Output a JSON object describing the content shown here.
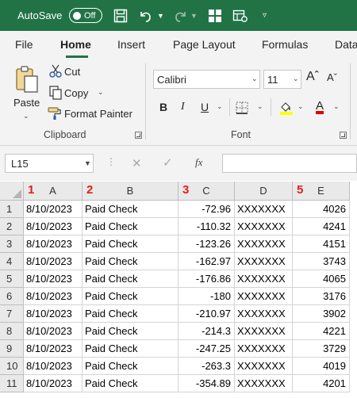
{
  "titlebar": {
    "autosave_label": "AutoSave",
    "toggle_label": "Off",
    "icons": [
      "save-icon",
      "undo-icon",
      "redo-icon",
      "table-icon",
      "form-icon",
      "customize-icon"
    ]
  },
  "tabs": [
    {
      "label": "File",
      "active": false
    },
    {
      "label": "Home",
      "active": true
    },
    {
      "label": "Insert",
      "active": false
    },
    {
      "label": "Page Layout",
      "active": false
    },
    {
      "label": "Formulas",
      "active": false
    },
    {
      "label": "Data",
      "active": false
    }
  ],
  "clipboard": {
    "paste_label": "Paste",
    "cut_label": "Cut",
    "copy_label": "Copy",
    "format_painter_label": "Format Painter",
    "group_label": "Clipboard"
  },
  "font": {
    "font_name": "Calibri",
    "font_size": "11",
    "bold": "B",
    "italic": "I",
    "underline": "U",
    "grow": "Aˆ",
    "shrink": "Aˇ",
    "color_a": "A",
    "group_label": "Font",
    "fill_color": "#ffff00",
    "font_color": "#e00000"
  },
  "formula_bar": {
    "name_box": "L15",
    "fx": "fx"
  },
  "grid": {
    "columns": [
      "A",
      "B",
      "C",
      "D",
      "E"
    ],
    "annotations": {
      "A": "1",
      "B": "2",
      "C": "3",
      "E": "5"
    },
    "rows": [
      {
        "n": "1",
        "A": "8/10/2023",
        "B": "Paid Check",
        "C": "-72.96",
        "D": "XXXXXXX",
        "E": "4026"
      },
      {
        "n": "2",
        "A": "8/10/2023",
        "B": "Paid Check",
        "C": "-110.32",
        "D": "XXXXXXX",
        "E": "4241"
      },
      {
        "n": "3",
        "A": "8/10/2023",
        "B": "Paid Check",
        "C": "-123.26",
        "D": "XXXXXXX",
        "E": "4151"
      },
      {
        "n": "4",
        "A": "8/10/2023",
        "B": "Paid Check",
        "C": "-162.97",
        "D": "XXXXXXX",
        "E": "3743"
      },
      {
        "n": "5",
        "A": "8/10/2023",
        "B": "Paid Check",
        "C": "-176.86",
        "D": "XXXXXXX",
        "E": "4065"
      },
      {
        "n": "6",
        "A": "8/10/2023",
        "B": "Paid Check",
        "C": "-180",
        "D": "XXXXXXX",
        "E": "3176"
      },
      {
        "n": "7",
        "A": "8/10/2023",
        "B": "Paid Check",
        "C": "-210.97",
        "D": "XXXXXXX",
        "E": "3902"
      },
      {
        "n": "8",
        "A": "8/10/2023",
        "B": "Paid Check",
        "C": "-214.3",
        "D": "XXXXXXX",
        "E": "4221"
      },
      {
        "n": "9",
        "A": "8/10/2023",
        "B": "Paid Check",
        "C": "-247.25",
        "D": "XXXXXXX",
        "E": "3729"
      },
      {
        "n": "10",
        "A": "8/10/2023",
        "B": "Paid Check",
        "C": "-263.3",
        "D": "XXXXXXX",
        "E": "4019"
      },
      {
        "n": "11",
        "A": "8/10/2023",
        "B": "Paid Check",
        "C": "-354.89",
        "D": "XXXXXXX",
        "E": "4201"
      }
    ]
  }
}
